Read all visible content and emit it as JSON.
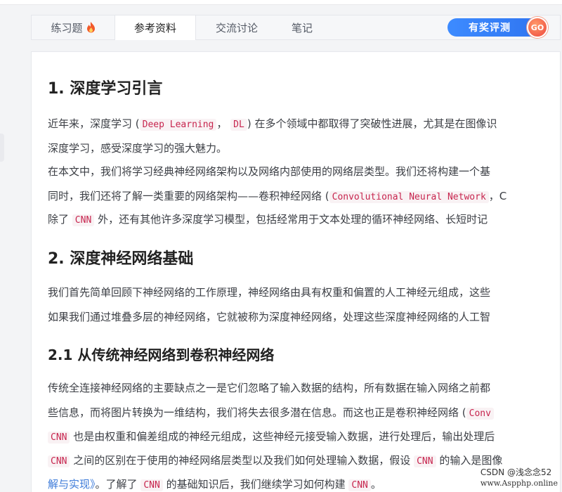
{
  "tabs": [
    {
      "label": "练习题",
      "icon": "flame-icon"
    },
    {
      "label": "参考资料"
    },
    {
      "label": "交流讨论"
    },
    {
      "label": "笔记"
    }
  ],
  "rate_button": {
    "label": "有奖评测",
    "badge": "GO"
  },
  "article": {
    "h1": "1. 深度学习引言",
    "p1a_pre": "近年来，深度学习 (",
    "p1a_code1": "Deep Learning",
    "p1a_sep": "，",
    "p1a_code2": "DL",
    "p1a_post": ") 在多个领域中都取得了突破性进展，尤其是在图像识",
    "p1b": "深度学习，感受深度学习的强大魅力。",
    "p2a": "在本文中，我们将学习经典神经网络架构以及网络内部使用的网络层类型。我们还将构建一个基",
    "p2b_pre": "同时，我们还将了解一类重要的网络架构——卷积神经网络 (",
    "p2b_code": "Convolutional Neural Network",
    "p2b_post": "，C",
    "p3_pre": "除了",
    "p3_code": "CNN",
    "p3_post": "外，还有其他许多深度学习模型，包括经常用于文本处理的循环神经网络、长短时记",
    "h2": "2. 深度神经网络基础",
    "p4": "我们首先简单回顾下神经网络的工作原理，神经网络由具有权重和偏置的人工神经元组成，这些",
    "p5": "如果我们通过堆叠多层的神经网络，它就被称为深度神经网络，处理这些深度神经网络的人工智",
    "h3": "2.1 从传统神经网络到卷积神经网络",
    "p6": "传统全连接神经网络的主要缺点之一是它们忽略了输入数据的结构，所有数据在输入网络之前都",
    "p7_pre": "些信息，而将图片转换为一维结构，我们将失去很多潜在信息。而这也正是卷积神经网络 (",
    "p7_code": "Conv",
    "p8_code": "CNN",
    "p8_post": "也是由权重和偏差组成的神经元组成，这些神经元接受输入数据，进行处理后，输出处理后",
    "p9_code1": "CNN",
    "p9_mid": "之间的区别在于使用的神经网络层类型以及我们如何处理输入数据，假设",
    "p9_code2": "CNN",
    "p9_post": "的输入是图像",
    "p10_link": "解与实现》",
    "p10_mid": "。了解了",
    "p10_code1": "CNN",
    "p10_mid2": "的基础知识后，我们继续学习如何构建",
    "p10_code2": "CNN",
    "p10_end": "。"
  },
  "watermark": {
    "prefix": "CSDN @",
    "name": "浅念念52",
    "url": "www.Aspphp.online"
  },
  "colors": {
    "accent": "#2f74f0",
    "code_text": "#c7254e",
    "code_bg": "#f9f2f4",
    "flame": "#f25a2b"
  }
}
